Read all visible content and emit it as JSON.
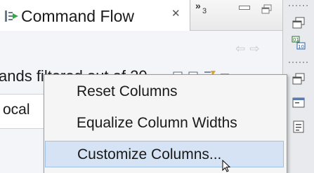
{
  "view_tab": {
    "title": "Command Flow",
    "close_glyph": "✕",
    "overflow_chevron": "»",
    "overflow_count": "3"
  },
  "toolbar": {
    "filter_status": "ands filtered out of 20",
    "icons": [
      "collapse-all-icon",
      "expand-all-icon",
      "filter-icon",
      "view-menu-icon"
    ]
  },
  "table": {
    "visible_cell": "ocal"
  },
  "context_menu": {
    "items": [
      {
        "label": "Reset Columns"
      },
      {
        "label": "Equalize Column Widths"
      },
      {
        "label": "Customize Columns..."
      }
    ],
    "hovered_index": 2
  },
  "colors": {
    "menu_hover": "#d5e3f4",
    "menu_hover_border": "#9ec0e6",
    "view_background": "#f3f5f8"
  }
}
